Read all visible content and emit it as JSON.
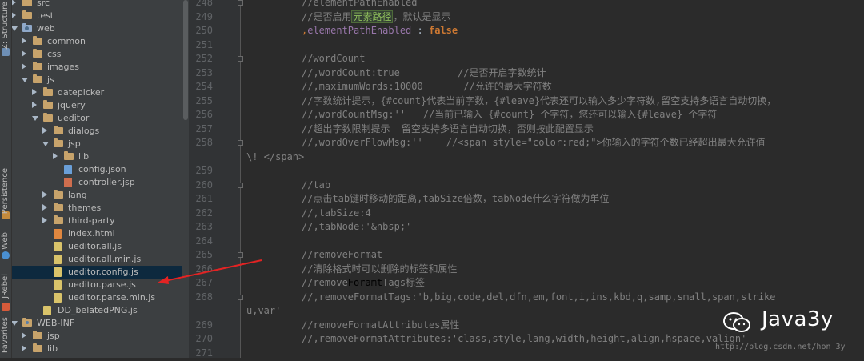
{
  "tool_windows": [
    {
      "label": "Z: Structure"
    },
    {
      "label": "Persistence"
    },
    {
      "label": "Web"
    },
    {
      "label": "JRebel"
    },
    {
      "label": "Favorites"
    }
  ],
  "tree": {
    "items": [
      {
        "label": "src",
        "kind": "folder",
        "arrow": "closed"
      },
      {
        "label": "test",
        "kind": "folder",
        "arrow": "closed"
      },
      {
        "label": "web",
        "kind": "web-folder",
        "arrow": "open"
      },
      {
        "label": "common",
        "kind": "folder",
        "arrow": "closed"
      },
      {
        "label": "css",
        "kind": "folder",
        "arrow": "closed"
      },
      {
        "label": "images",
        "kind": "folder",
        "arrow": "closed"
      },
      {
        "label": "js",
        "kind": "folder",
        "arrow": "open"
      },
      {
        "label": "datepicker",
        "kind": "folder",
        "arrow": "closed"
      },
      {
        "label": "jquery",
        "kind": "folder",
        "arrow": "closed"
      },
      {
        "label": "ueditor",
        "kind": "folder",
        "arrow": "open"
      },
      {
        "label": "dialogs",
        "kind": "folder",
        "arrow": "closed"
      },
      {
        "label": "jsp",
        "kind": "folder",
        "arrow": "open"
      },
      {
        "label": "lib",
        "kind": "folder",
        "arrow": "closed"
      },
      {
        "label": "config.json",
        "kind": "json"
      },
      {
        "label": "controller.jsp",
        "kind": "jsp"
      },
      {
        "label": "lang",
        "kind": "folder",
        "arrow": "closed"
      },
      {
        "label": "themes",
        "kind": "folder",
        "arrow": "closed"
      },
      {
        "label": "third-party",
        "kind": "folder",
        "arrow": "closed"
      },
      {
        "label": "index.html",
        "kind": "html"
      },
      {
        "label": "ueditor.all.js",
        "kind": "js"
      },
      {
        "label": "ueditor.all.min.js",
        "kind": "js"
      },
      {
        "label": "ueditor.config.js",
        "kind": "js",
        "selected": true
      },
      {
        "label": "ueditor.parse.js",
        "kind": "js"
      },
      {
        "label": "ueditor.parse.min.js",
        "kind": "js"
      },
      {
        "label": "DD_belatedPNG.js",
        "kind": "js"
      },
      {
        "label": "WEB-INF",
        "kind": "dot-folder",
        "arrow": "open"
      },
      {
        "label": "jsp",
        "kind": "folder",
        "arrow": "closed"
      },
      {
        "label": "lib",
        "kind": "folder",
        "arrow": "closed"
      }
    ]
  },
  "editor": {
    "lines": [
      {
        "n": "248",
        "segs": [
          {
            "t": "//elementPathEnabled",
            "c": "comment"
          }
        ]
      },
      {
        "n": "249",
        "segs": [
          {
            "t": "//是否启用",
            "c": "comment"
          },
          {
            "t": "元素路径",
            "c": "hl"
          },
          {
            "t": "，默认是显示",
            "c": "comment"
          }
        ]
      },
      {
        "n": "250",
        "segs": [
          {
            "t": ",",
            "c": "kw"
          },
          {
            "t": "elementPathEnabled",
            "c": "field"
          },
          {
            "t": " : ",
            "c": "plain"
          },
          {
            "t": "false",
            "c": "bool"
          }
        ]
      },
      {
        "n": "251",
        "segs": []
      },
      {
        "n": "252",
        "segs": [
          {
            "t": "//wordCount",
            "c": "comment"
          }
        ]
      },
      {
        "n": "253",
        "segs": [
          {
            "t": "//,wordCount:true          //是否开启字数统计",
            "c": "comment"
          }
        ]
      },
      {
        "n": "254",
        "segs": [
          {
            "t": "//,maximumWords:10000       //允许的最大字符数",
            "c": "comment"
          }
        ]
      },
      {
        "n": "255",
        "segs": [
          {
            "t": "//字数统计提示，{#count}代表当前字数，{#leave}代表还可以输入多少字符数,留空支持多语言自动切换，",
            "c": "comment"
          }
        ]
      },
      {
        "n": "256",
        "segs": [
          {
            "t": "//,wordCountMsg:''   //当前已输入 {#count} 个字符，您还可以输入{#leave} 个字符",
            "c": "comment"
          }
        ]
      },
      {
        "n": "257",
        "segs": [
          {
            "t": "//超出字数限制提示  留空支持多语言自动切换，否则按此配置显示",
            "c": "comment"
          }
        ]
      },
      {
        "n": "258",
        "segs": [
          {
            "t": "//,wordOverFlowMsg:''    //<span style=\"color:red;\">你输入的字符个数已经超出最大允许值",
            "c": "comment"
          }
        ]
      },
      {
        "n": "",
        "wrap": true,
        "segs": [
          {
            "t": "\\! </span>",
            "c": "comment"
          }
        ]
      },
      {
        "n": "259",
        "segs": []
      },
      {
        "n": "260",
        "segs": [
          {
            "t": "//tab",
            "c": "comment"
          }
        ]
      },
      {
        "n": "261",
        "segs": [
          {
            "t": "//点击tab键时移动的距离,tabSize倍数，tabNode什么字符做为单位",
            "c": "comment"
          }
        ]
      },
      {
        "n": "262",
        "segs": [
          {
            "t": "//,tabSize:4",
            "c": "comment"
          }
        ]
      },
      {
        "n": "263",
        "segs": [
          {
            "t": "//,tabNode:'&nbsp;'",
            "c": "comment"
          }
        ]
      },
      {
        "n": "264",
        "segs": []
      },
      {
        "n": "265",
        "segs": [
          {
            "t": "//removeFormat",
            "c": "comment"
          }
        ]
      },
      {
        "n": "266",
        "segs": [
          {
            "t": "//清除格式时可以删除的标签和属性",
            "c": "comment"
          }
        ]
      },
      {
        "n": "267",
        "segs": [
          {
            "t": "//remove",
            "c": "comment"
          },
          {
            "t": "Foramt",
            "c": "ul"
          },
          {
            "t": "Tags标签",
            "c": "comment"
          }
        ]
      },
      {
        "n": "268",
        "segs": [
          {
            "t": "//,removeFormatTags:'b,big,code,del,dfn,em,font,i,ins,kbd,q,samp,small,span,strike",
            "c": "comment"
          }
        ]
      },
      {
        "n": "",
        "wrap": true,
        "segs": [
          {
            "t": "u,var'",
            "c": "comment"
          }
        ]
      },
      {
        "n": "269",
        "segs": [
          {
            "t": "//removeFormatAttributes属性",
            "c": "comment"
          }
        ]
      },
      {
        "n": "270",
        "segs": [
          {
            "t": "//,removeFormatAttributes:'class,style,lang,width,height,align,hspace,valign'",
            "c": "comment"
          }
        ]
      },
      {
        "n": "271",
        "segs": []
      }
    ]
  },
  "watermark": {
    "text": "Java3y",
    "url": "http://blog.csdn.net/hon_3y"
  },
  "colors": {
    "selection": "#0d293e",
    "arrow": "#e32323"
  }
}
